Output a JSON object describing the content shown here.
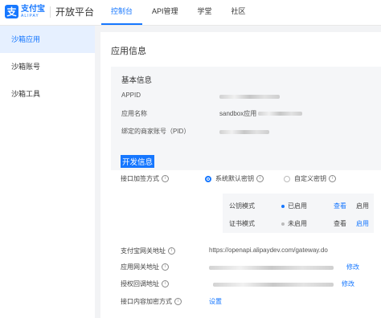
{
  "header": {
    "logo_glyph": "支",
    "logo_cn": "支付宝",
    "logo_en": "ALIPAY",
    "platform": "开放平台",
    "nav": [
      "控制台",
      "API管理",
      "学堂",
      "社区"
    ],
    "active_nav": "控制台"
  },
  "sidebar": {
    "items": [
      "沙箱应用",
      "沙箱账号",
      "沙箱工具"
    ]
  },
  "main": {
    "title": "应用信息",
    "basic": {
      "title": "基本信息",
      "appid_label": "APPID",
      "name_label": "应用名称",
      "name_value_prefix": "sandbox应用",
      "pid_label": "绑定的商家账号（PID）"
    },
    "dev": {
      "title": "开发信息",
      "sign_label": "接口加签方式",
      "option_system": "系统默认密钥",
      "option_custom": "自定义密钥",
      "pubkey_mode": "公钥模式",
      "pubkey_status": "已启用",
      "cert_mode": "证书模式",
      "cert_status": "未启用",
      "view": "查看",
      "enable": "启用",
      "gateway_label": "支付宝网关地址",
      "gateway_value": "https://openapi.alipaydev.com/gateway.do",
      "app_gateway_label": "应用网关地址",
      "auth_callback_label": "授权回调地址",
      "modify": "修改",
      "encrypt_label": "接口内容加密方式",
      "setup": "设置"
    }
  },
  "colors": {
    "accent": "#1677ff",
    "enabled_dot": "#1677ff",
    "disabled_dot": "#bbbbbb"
  }
}
